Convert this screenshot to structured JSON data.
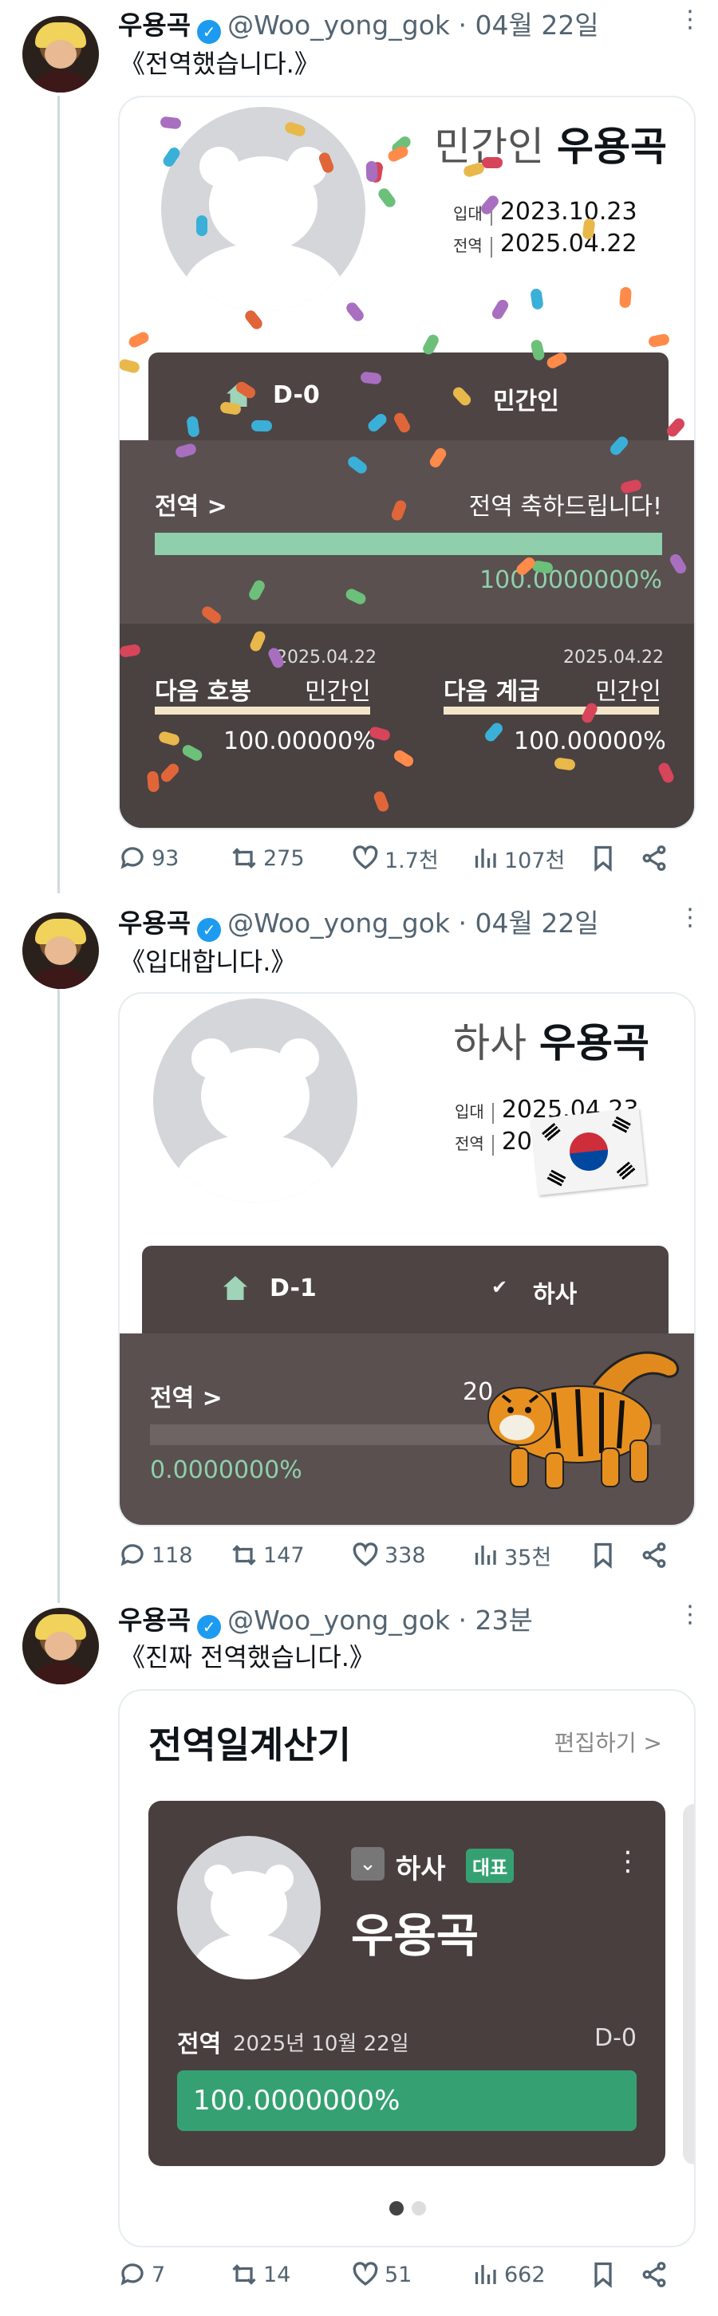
{
  "posts": [
    {
      "name": "우용곡",
      "handle": "@Woo_yong_gok",
      "time": "· 04월 22일",
      "text": "《전역했습니다.》",
      "card": {
        "status": "민간인",
        "name": "우용곡",
        "enlist_label": "입대",
        "enlist_date": "2023.10.23",
        "discharge_label": "전역",
        "discharge_date": "2025.04.22",
        "dday": "D-0",
        "rank_tab": "민간인",
        "progress_label": "전역 >",
        "progress_msg": "전역 축하드립니다!",
        "progress_pct": "100.0000000%",
        "progress_value": 100,
        "next_pay_label": "다음 호봉",
        "next_pay_date": "2025.04.22",
        "next_pay_rank": "민간인",
        "next_pay_pct": "100.00000%",
        "next_rank_label": "다음 계급",
        "next_rank_date": "2025.04.22",
        "next_rank_rank": "민간인",
        "next_rank_pct": "100.00000%"
      },
      "stats": {
        "replies": "93",
        "reposts": "275",
        "likes": "1.7천",
        "views": "107천"
      }
    },
    {
      "name": "우용곡",
      "handle": "@Woo_yong_gok",
      "time": "· 04월 22일",
      "text": "《입대합니다.》",
      "card": {
        "status": "하사",
        "name": "우용곡",
        "enlist_label": "입대",
        "enlist_date": "2025.04.23",
        "discharge_label": "전역",
        "discharge_date_partial": "20",
        "dday": "D-1",
        "rank_tab": "하사",
        "progress_label": "전역 >",
        "progress_msg_partial": "20",
        "progress_pct": "0.0000000%",
        "progress_value": 0
      },
      "stats": {
        "replies": "118",
        "reposts": "147",
        "likes": "338",
        "views": "35천"
      }
    },
    {
      "name": "우용곡",
      "handle": "@Woo_yong_gok",
      "time": "· 23분",
      "text": "《진짜 전역했습니다.》",
      "card": {
        "title": "전역일계산기",
        "edit": "편집하기 >",
        "rank": "하사",
        "badge": "대표",
        "name": "우용곡",
        "label": "전역",
        "date": "2025년 10월 22일",
        "dday": "D-0",
        "pct": "100.0000000%",
        "progress_value": 100
      },
      "stats": {
        "replies": "7",
        "reposts": "14",
        "likes": "51",
        "views": "662"
      }
    }
  ],
  "colors": {
    "accent": "#1d9bf0",
    "progress_mint": "#8fcfab",
    "progress_green": "#35a173",
    "card_dark": "#4e4444"
  }
}
